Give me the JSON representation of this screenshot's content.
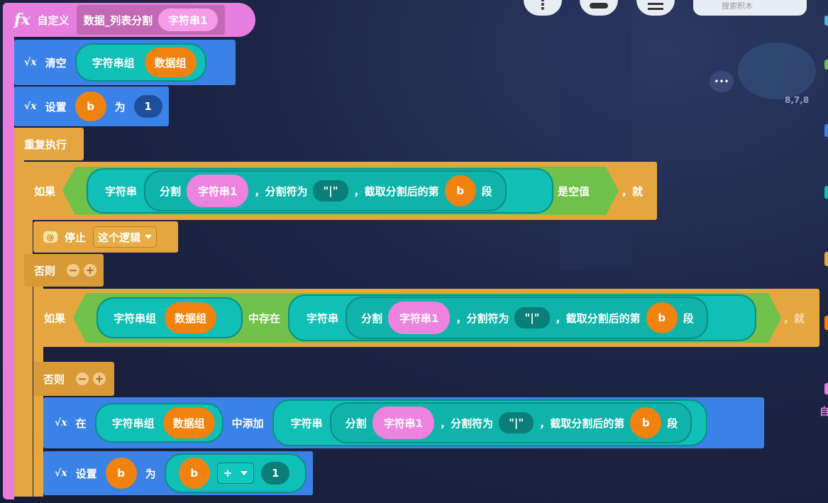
{
  "toolbar": {
    "btn1": "⋮",
    "search_label": "搜索积木"
  },
  "side_tag": "8,7,8",
  "side_text": "自",
  "define": {
    "keyword": "自定义",
    "function_name": "数据_列表分割",
    "param": "字符串1"
  },
  "clear": {
    "label": "清空",
    "list_type": "字符串组",
    "list_name": "数据组"
  },
  "set1": {
    "label": "设置",
    "var": "b",
    "to": "为",
    "value": "1"
  },
  "repeat": {
    "label": "重复执行"
  },
  "if1": {
    "if_label": "如果",
    "string": "字符串",
    "split": "分割",
    "param": "字符串1",
    "delim_label": "，分割符为",
    "delim": "\"|\"",
    "take_label": "，截取分割后的第",
    "index_var": "b",
    "seg": "段",
    "is_empty": "是空值",
    "then": "，就"
  },
  "stop": {
    "label": "停止",
    "option": "这个逻辑"
  },
  "else1": {
    "label": "否则"
  },
  "if2": {
    "if_label": "如果",
    "list_type": "字符串组",
    "list_name": "数据组",
    "exists": "中存在",
    "string": "字符串",
    "split": "分割",
    "param": "字符串1",
    "delim_label": "，分割符为",
    "delim": "\"|\"",
    "take_label": "，截取分割后的第",
    "index_var": "b",
    "seg": "段",
    "then": "，就"
  },
  "else2": {
    "label": "否则"
  },
  "add": {
    "at": "在",
    "list_type": "字符串组",
    "list_name": "数据组",
    "add_label": "中添加",
    "string": "字符串",
    "split": "分割",
    "param": "字符串1",
    "delim_label": "，分割符为",
    "delim": "\"|\"",
    "take_label": "，截取分割后的第",
    "index_var": "b",
    "seg": "段"
  },
  "set2": {
    "label": "设置",
    "var": "b",
    "to": "为",
    "left": "b",
    "op": "+",
    "right": "1"
  },
  "minus": "−",
  "plus": "+",
  "colors": {
    "pink": "#e67ddf",
    "blue": "#3b82e8",
    "gold": "#e6a63f",
    "teal": "#10bfb5",
    "orange": "#f0820f",
    "green": "#6fc14a"
  }
}
